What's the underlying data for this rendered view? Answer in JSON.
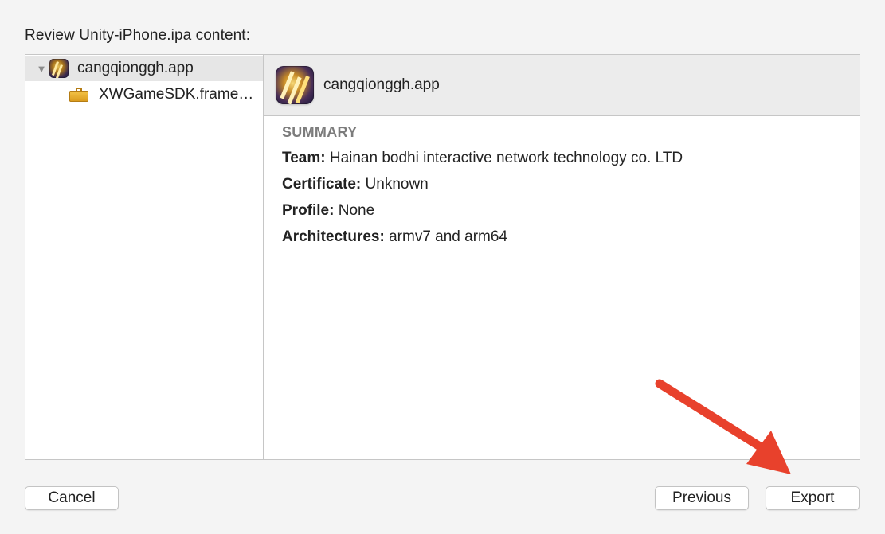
{
  "heading": "Review Unity-iPhone.ipa content:",
  "sidebar": {
    "items": [
      {
        "label": "cangqionggh.app",
        "icon": "app-icon",
        "expanded": true,
        "selected": true,
        "disclosure": "▼"
      },
      {
        "label": "XWGameSDK.frame…",
        "icon": "framework-briefcase-icon",
        "selected": false
      }
    ]
  },
  "detail": {
    "title": "cangqionggh.app",
    "icon": "app-icon",
    "summary": {
      "heading": "SUMMARY",
      "rows": [
        {
          "key": "Team:",
          "value": "Hainan bodhi interactive network technology co. LTD"
        },
        {
          "key": "Certificate:",
          "value": "Unknown"
        },
        {
          "key": "Profile:",
          "value": "None"
        },
        {
          "key": "Architectures:",
          "value": "armv7 and arm64"
        }
      ]
    }
  },
  "buttons": {
    "cancel": "Cancel",
    "previous": "Previous",
    "export": "Export"
  },
  "annotation": {
    "arrow_color": "#e8412c",
    "points_to": "export-button"
  },
  "colors": {
    "background": "#f4f4f4",
    "selection": "#e6e6e6",
    "header_bar": "#ececec",
    "summary_heading": "#7c7c7c"
  }
}
